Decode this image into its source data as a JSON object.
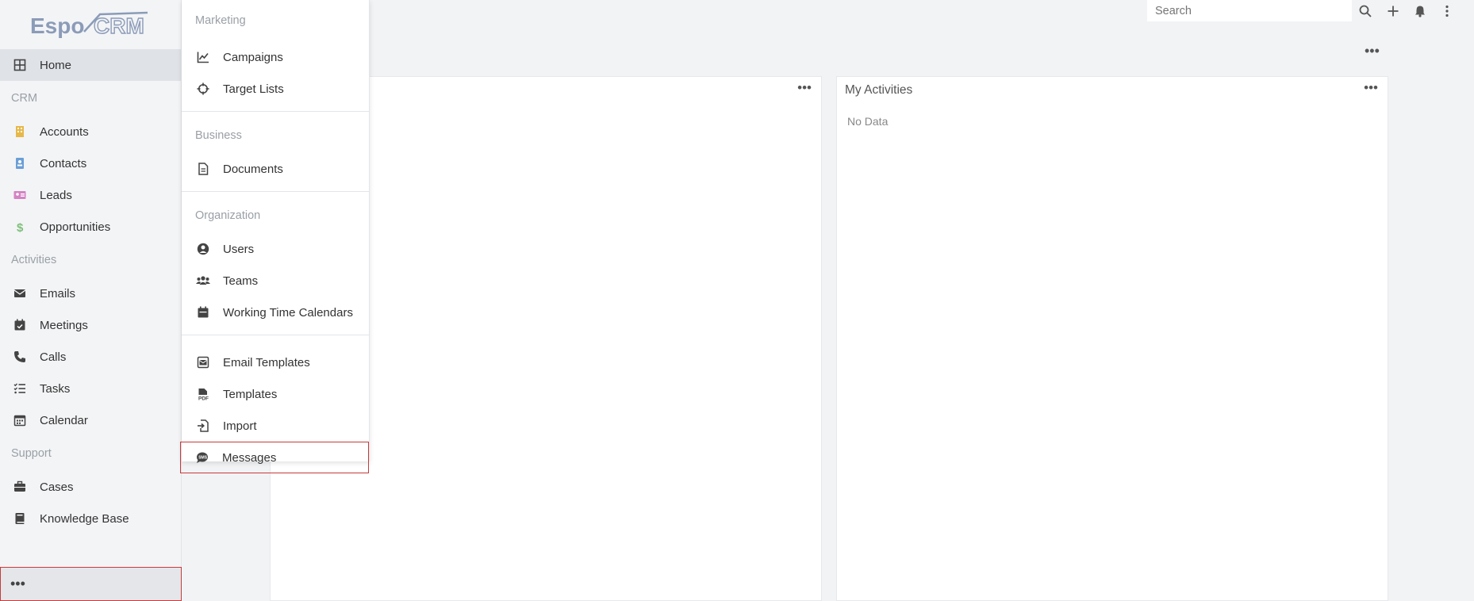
{
  "brand": {
    "logo_text": "EspoCRM",
    "accent": "#6f87b0"
  },
  "sidebar": {
    "home": {
      "label": "Home",
      "icon": "grid-icon"
    },
    "groups": [
      {
        "label": "CRM",
        "items": [
          {
            "label": "Accounts",
            "icon": "building-icon",
            "color": "#e6b84a"
          },
          {
            "label": "Contacts",
            "icon": "contact-card-icon",
            "color": "#6b9fd6"
          },
          {
            "label": "Leads",
            "icon": "id-card-icon",
            "color": "#d483c4"
          },
          {
            "label": "Opportunities",
            "icon": "dollar-icon",
            "color": "#7ec07a"
          }
        ]
      },
      {
        "label": "Activities",
        "items": [
          {
            "label": "Emails",
            "icon": "envelope-icon"
          },
          {
            "label": "Meetings",
            "icon": "calendar-check-icon"
          },
          {
            "label": "Calls",
            "icon": "phone-icon"
          },
          {
            "label": "Tasks",
            "icon": "list-check-icon"
          },
          {
            "label": "Calendar",
            "icon": "calendar-icon"
          }
        ]
      },
      {
        "label": "Support",
        "items": [
          {
            "label": "Cases",
            "icon": "briefcase-icon"
          },
          {
            "label": "Knowledge Base",
            "icon": "book-icon"
          }
        ]
      }
    ],
    "more_label": "•••"
  },
  "dropdown": {
    "groups": [
      {
        "label": "Marketing",
        "items": [
          {
            "label": "Campaigns",
            "icon": "chart-line-icon"
          },
          {
            "label": "Target Lists",
            "icon": "crosshairs-icon"
          }
        ]
      },
      {
        "label": "Business",
        "items": [
          {
            "label": "Documents",
            "icon": "file-icon"
          }
        ]
      },
      {
        "label": "Organization",
        "items": [
          {
            "label": "Users",
            "icon": "user-circle-icon"
          },
          {
            "label": "Teams",
            "icon": "users-icon"
          },
          {
            "label": "Working Time Calendars",
            "icon": "calendar-icon"
          }
        ]
      },
      {
        "label": "",
        "items": [
          {
            "label": "Email Templates",
            "icon": "envelope-square-icon"
          },
          {
            "label": "Templates",
            "icon": "pdf-file-icon"
          },
          {
            "label": "Import",
            "icon": "file-import-icon"
          },
          {
            "label": "Messages",
            "icon": "sms-icon"
          }
        ]
      }
    ]
  },
  "topbar": {
    "search_placeholder": "Search"
  },
  "dashboard": {
    "more_label": "•••",
    "panels": [
      {
        "title": "",
        "menu": "•••"
      },
      {
        "title": "My Activities",
        "menu": "•••",
        "empty_text": "No Data"
      }
    ]
  }
}
